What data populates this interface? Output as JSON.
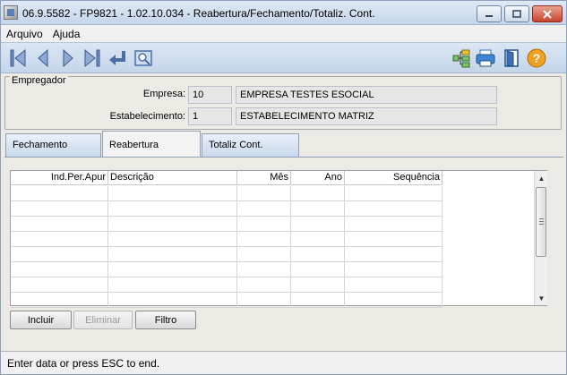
{
  "window": {
    "title": "06.9.5582 - FP9821 - 1.02.10.034 - Reabertura/Fechamento/Totaliz. Cont.",
    "minimize_icon": "minimize-icon",
    "maximize_icon": "maximize-icon",
    "close_icon": "close-icon"
  },
  "menu": {
    "items": [
      "Arquivo",
      "Ajuda"
    ]
  },
  "toolbar": {
    "icons": [
      "first-record-icon",
      "previous-record-icon",
      "next-record-icon",
      "last-record-icon",
      "return-icon",
      "preview-icon",
      "tree-icon",
      "print-icon",
      "exit-door-icon",
      "help-icon"
    ]
  },
  "empregador": {
    "title": "Empregador",
    "empresa_label": "Empresa:",
    "empresa_code": "10",
    "empresa_name": "EMPRESA TESTES ESOCIAL",
    "estab_label": "Estabelecimento:",
    "estab_code": "1",
    "estab_name": "ESTABELECIMENTO MATRIZ"
  },
  "tabs": [
    {
      "label": "Fechamento",
      "active": false
    },
    {
      "label": "Reabertura",
      "active": true
    },
    {
      "label": "Totaliz Cont.",
      "active": false
    }
  ],
  "grid": {
    "columns": [
      "Ind.Per.Apur",
      "Descrição",
      "Mês",
      "Ano",
      "Sequência"
    ],
    "rows": [
      [],
      [],
      [],
      [],
      [],
      [],
      [],
      []
    ]
  },
  "buttons": {
    "incluir": "Incluir",
    "eliminar": "Eliminar",
    "filtro": "Filtro"
  },
  "status": {
    "text": "Enter data or press ESC to end."
  },
  "colors": {
    "accent": "#2f6fc0",
    "help": "#f0a020",
    "close": "#c8432b"
  }
}
